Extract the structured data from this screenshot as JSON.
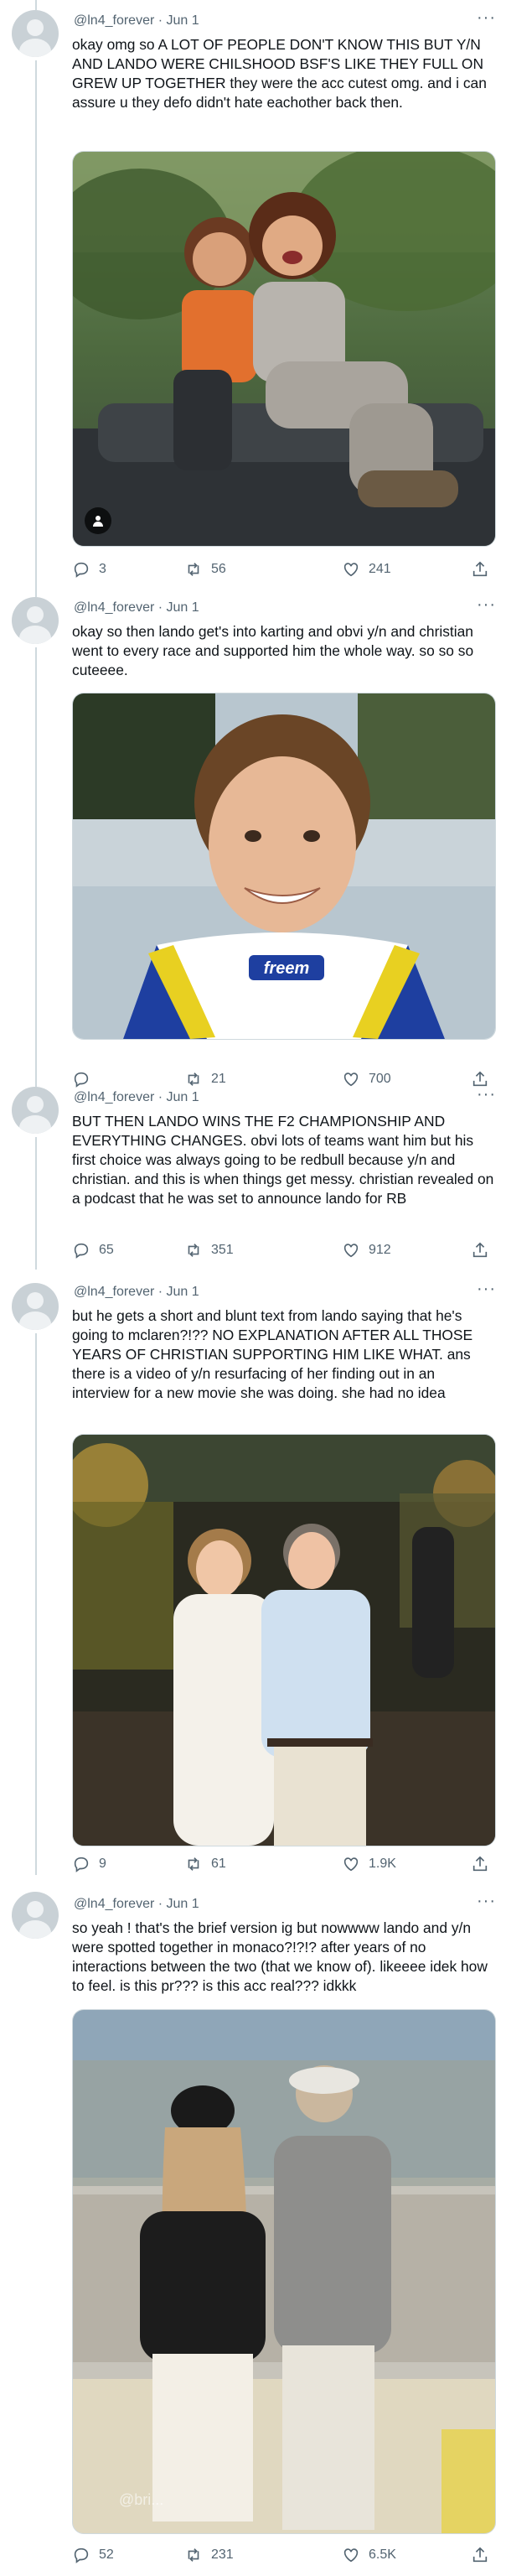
{
  "tweets": [
    {
      "handle": "@ln4_forever",
      "date": "Jun 1",
      "more": "···",
      "text": "okay omg so A LOT OF PEOPLE DON'T KNOW THIS BUT Y/N AND LANDO WERE CHILSHOOD BSF'S LIKE THEY FULL ON GREW UP TOGETHER they were the acc cutest omg. and i can assure u they defo didn't hate eachother back then.",
      "replies": "3",
      "retweets": "56",
      "likes": "241"
    },
    {
      "handle": "@ln4_forever",
      "date": "Jun 1",
      "more": "···",
      "text": "okay so then lando get's into karting and obvi y/n and christian went to every race and supported him the whole way. so so so cuteeee.",
      "media_text": "freem",
      "replies": "",
      "retweets": "21",
      "likes": "700"
    },
    {
      "handle": "@ln4_forever",
      "date": "Jun 1",
      "more": "···",
      "text": "BUT THEN LANDO WINS THE F2 CHAMPIONSHIP AND EVERYTHING CHANGES. obvi lots of teams want him but his first choice was always going to be redbull because y/n and christian. and this is when things get messy. christian revealed on a podcast that he was set to announce lando for RB",
      "replies": "65",
      "retweets": "351",
      "likes": "912"
    },
    {
      "handle": "@ln4_forever",
      "date": "Jun 1",
      "more": "···",
      "text": "but he gets a short and blunt text from lando saying that he's going to mclaren?!?? NO EXPLANATION AFTER ALL THOSE YEARS OF CHRISTIAN SUPPORTING HIM LIKE WHAT. ans there is a video of y/n resurfacing of her finding out in an interview for a new movie she was doing. she had no idea",
      "replies": "9",
      "retweets": "61",
      "likes": "1.9K"
    },
    {
      "handle": "@ln4_forever",
      "date": "Jun 1",
      "more": "···",
      "text": "so yeah ! that's the brief version ig but nowwww lando and y/n were spotted together in monaco?!?!? after years of no interactions between the two (that we know of). likeeee idek how to feel. is this pr??? is this acc real??? idkkk",
      "media_text": "@bri...",
      "replies": "52",
      "retweets": "231",
      "likes": "6.5K"
    }
  ],
  "colors": {
    "text": "#0f1419",
    "secondary": "#536471",
    "thread_line": "#cfd9de",
    "background": "#ffffff"
  },
  "icons": [
    "reply-icon",
    "retweet-icon",
    "like-icon",
    "share-icon",
    "person-icon"
  ]
}
